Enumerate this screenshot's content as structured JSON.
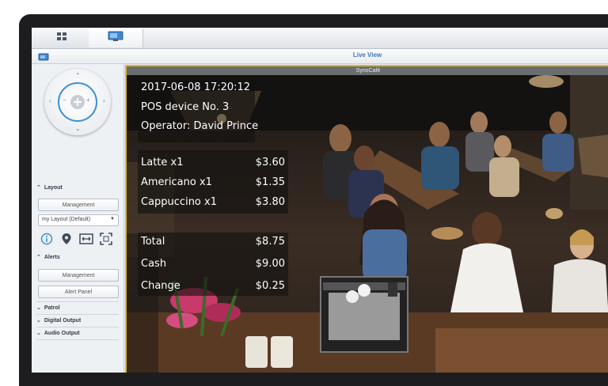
{
  "tabs": [
    {
      "name": "overview",
      "icon": "grid-icon"
    },
    {
      "name": "live-view",
      "icon": "camera-monitor-icon"
    }
  ],
  "window": {
    "title": "Live View",
    "panel_icon": "camera-monitor-icon"
  },
  "sidebar": {
    "layout": {
      "header": "Layout",
      "management": "Management",
      "select_value": "my Layout (Default)"
    },
    "alerts": {
      "header": "Alerts",
      "management": "Management",
      "alert_panel": "Alert Panel"
    },
    "collapsed": [
      "Patrol",
      "Digital Output",
      "Audio Output"
    ]
  },
  "camera": {
    "name": "SynoCafé",
    "frame_color": "#e2b324"
  },
  "pos_overlay": {
    "timestamp": "2017-06-08 17:20:12",
    "device": "POS device No. 3",
    "operator": "Operator:  David Prince",
    "items": [
      {
        "name": "Latte x1",
        "price": "$3.60"
      },
      {
        "name": "Americano x1",
        "price": "$1.35"
      },
      {
        "name": "Cappuccino x1",
        "price": "$3.80"
      }
    ],
    "totals": [
      {
        "label": "Total",
        "value": "$8.75"
      },
      {
        "label": "Cash",
        "value": "$9.00"
      },
      {
        "label": "Change",
        "value": "$0.25"
      }
    ]
  }
}
